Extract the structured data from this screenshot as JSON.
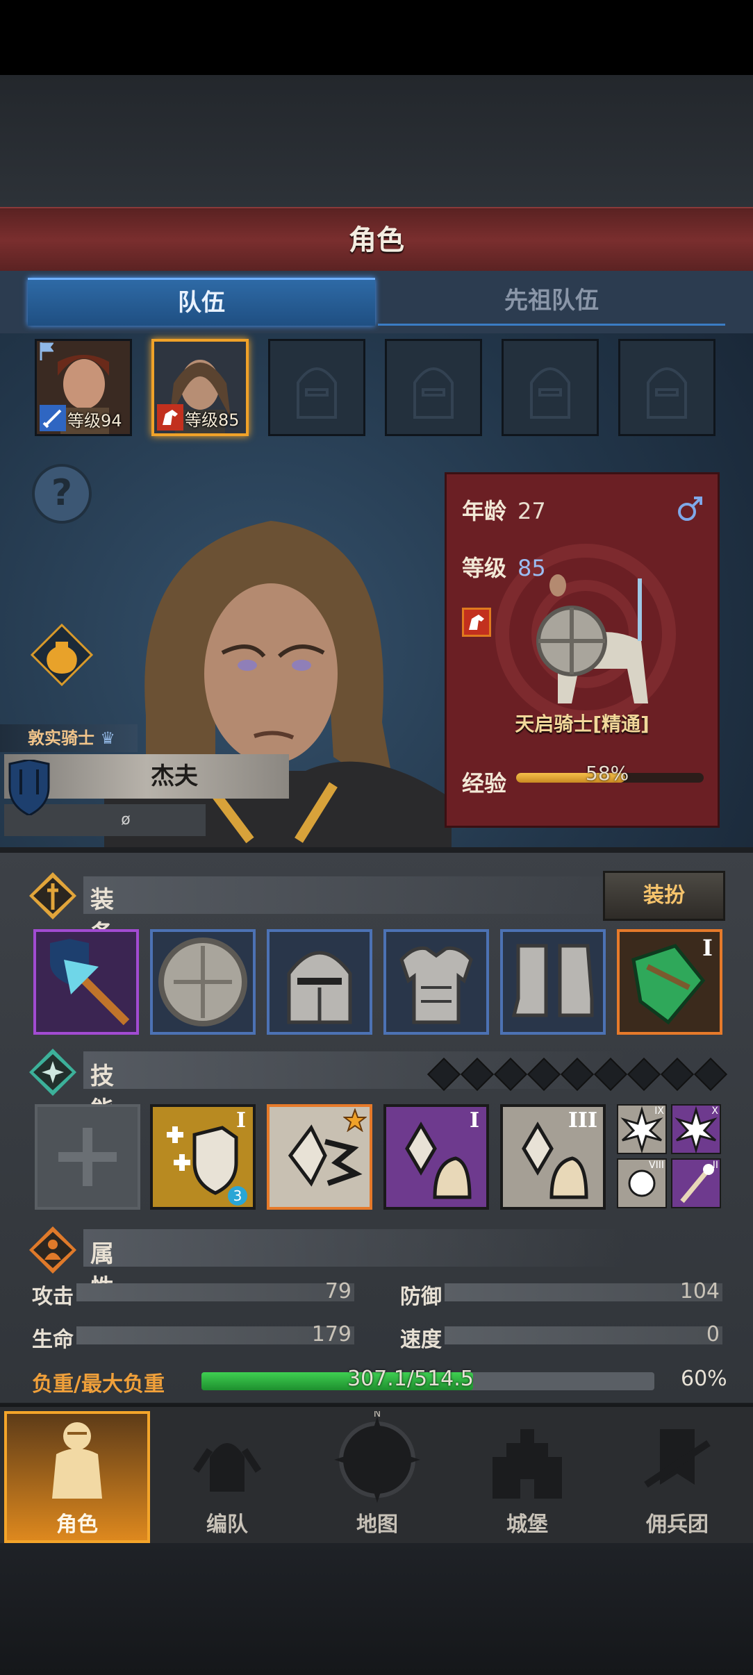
{
  "title": "角色",
  "tabs": {
    "active": "队伍",
    "inactive": "先祖队伍"
  },
  "party": [
    {
      "level": "等级94"
    },
    {
      "level": "等级85"
    }
  ],
  "info": {
    "age_label": "年龄",
    "age": "27",
    "level_label": "等级",
    "level": "85",
    "gender_icon": "male-symbol-icon",
    "class_name": "天启骑士[精通]",
    "xp_label": "经验",
    "xp": "58%",
    "xp_fraction": 0.58
  },
  "hero": {
    "title": "敦实骑士",
    "name": "杰夫",
    "sub": "ø"
  },
  "equipment": {
    "label": "装备",
    "dress_button": "装扮",
    "ring_tier": "I"
  },
  "skills": {
    "label": "技能",
    "tiers": [
      "I",
      "I",
      "III"
    ],
    "mini_tiers": [
      "IX",
      "X",
      "VIII",
      "II"
    ],
    "badge": "3"
  },
  "attributes": {
    "label": "属性",
    "attack_label": "攻击",
    "attack": "79",
    "defense_label": "防御",
    "defense": "104",
    "hp_label": "生命",
    "hp": "179",
    "speed_label": "速度",
    "speed": "0",
    "load_label": "负重/最大负重",
    "load": "307.1/514.5",
    "load_pct": "60%",
    "load_fraction": 0.6
  },
  "nav": [
    "角色",
    "编队",
    "地图",
    "城堡",
    "佣兵团"
  ],
  "colors": {
    "accent": "#f0a229",
    "tab_blue": "#2e6aa6",
    "panel_red": "#6b1f24",
    "load_green": "#3fcf52"
  }
}
